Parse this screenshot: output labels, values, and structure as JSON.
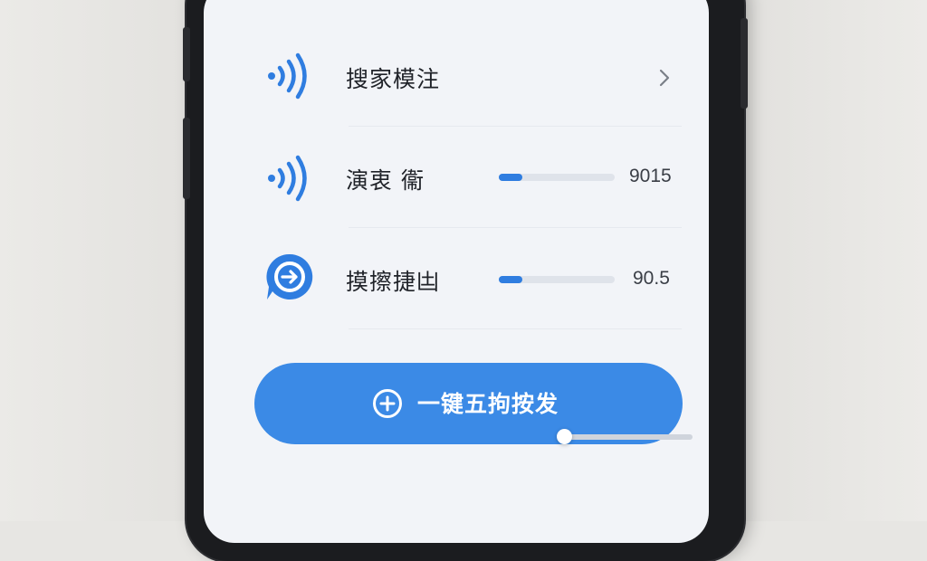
{
  "list": {
    "items": [
      {
        "label": "搜家模注",
        "icon": "wifi-signal-icon",
        "action": "chevron-right-icon"
      },
      {
        "label": "演衷 衞",
        "icon": "wifi-signal-icon",
        "value": "9015",
        "progress": 0.2
      },
      {
        "label": "摸擦捷凷",
        "icon": "location-pin-icon",
        "value": "90.5",
        "progress": 0.2
      }
    ]
  },
  "primary_button": {
    "label": "一键五拘按发",
    "icon": "plus-circle-icon"
  },
  "slider": {
    "level": 0.0
  },
  "colors": {
    "accent": "#3b8ae6",
    "icon_blue": "#2f7de0",
    "screen_bg": "#f2f4f8"
  }
}
